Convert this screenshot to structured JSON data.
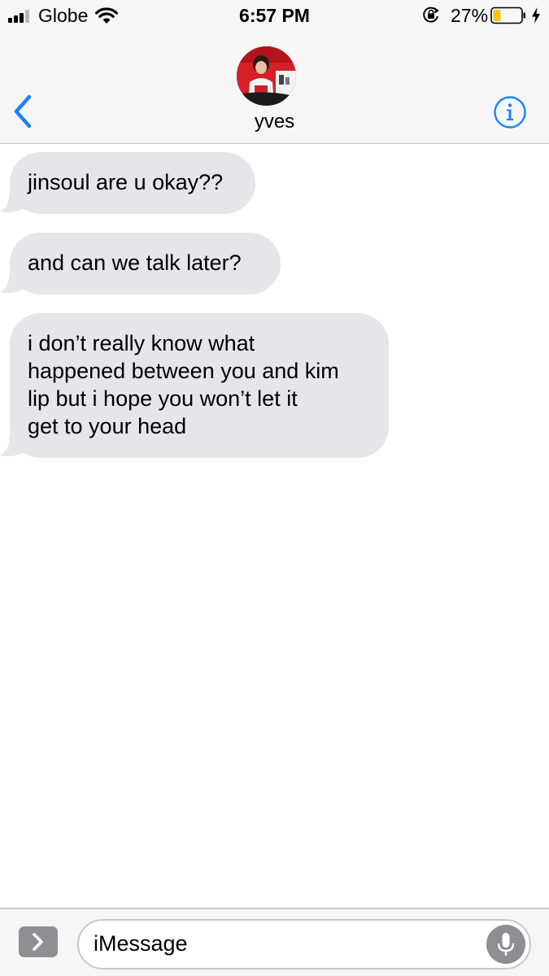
{
  "status_bar": {
    "carrier": "Globe",
    "time": "6:57 PM",
    "battery_percent": "27%",
    "battery_level": 0.27,
    "icons": [
      "signal-icon",
      "wifi-icon",
      "orientation-lock-icon",
      "battery-icon",
      "charging-bolt-icon"
    ]
  },
  "nav": {
    "contact_name": "yves",
    "back_icon": "chevron-left-icon",
    "info_icon": "info-icon"
  },
  "messages": [
    {
      "direction": "incoming",
      "lines": [
        "jinsoul are u okay??"
      ]
    },
    {
      "direction": "incoming",
      "lines": [
        "and can we talk later?"
      ]
    },
    {
      "direction": "incoming",
      "lines": [
        "i don’t really know what",
        "happened between you and kim",
        "lip but i hope you won’t let it",
        "get to your head"
      ]
    }
  ],
  "input_bar": {
    "placeholder": "iMessage",
    "apps_icon": "chevron-right-icon",
    "mic_icon": "microphone-icon"
  },
  "colors": {
    "accent": "#1a82fb",
    "incoming_bubble": "#e5e5ea",
    "bar_background": "#f6f6f6",
    "separator": "#c8c8cc",
    "battery_low": "#f5c40b"
  }
}
